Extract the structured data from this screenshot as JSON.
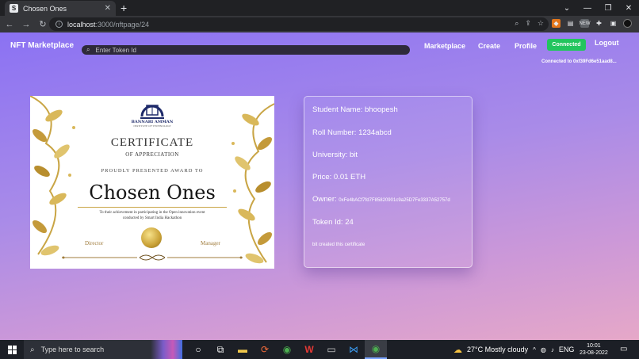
{
  "browser": {
    "tab_title": "Chosen Ones",
    "tab_favicon": "S",
    "url_host": "localhost",
    "url_path": ":3000/nftpage/24",
    "extension_badge": "NEW"
  },
  "navbar": {
    "brand": "NFT Marketplace",
    "search_placeholder": "Enter Token Id",
    "links": [
      "Marketplace",
      "Create",
      "Profile"
    ],
    "connected_label": "Connected",
    "logout_label": "Logout",
    "connection_text": "Connected to 0xf39Fd6e51aad8..."
  },
  "certificate": {
    "college": "BANNARI AMMAN",
    "college_sub": "INSTITUTE OF TECHNOLOGY",
    "heading": "CERTIFICATE",
    "subheading": "OF APPRECIATION",
    "presented": "PROUDLY PRESENTED AWARD TO",
    "recipient": "Chosen Ones",
    "desc_line1": "To their achievement in participating in the Open innovation event",
    "desc_line2": "conducted by Smart India Hackathon",
    "sig_left": "Director",
    "sig_right": "Manager"
  },
  "details": {
    "student_name": "Student Name: bhoopesh",
    "roll_number": "Roll Number: 1234abcd",
    "university": "University: bit",
    "price": "Price: 0.01 ETH",
    "owner_label": "Owner:",
    "owner_value": "0xFe4bACf7fd7F85820901c9a25D7Fe3337A52757d",
    "token_id": "Token Id: 24",
    "note": "bit created this certificate"
  },
  "taskbar": {
    "search_placeholder": "Type here to search",
    "weather": "27°C  Mostly cloudy",
    "language": "ENG",
    "time": "10:01",
    "date": "23-08-2022"
  },
  "colors": {
    "connected_green": "#22c55e",
    "page_gradient_top": "#8b72f3",
    "page_gradient_bottom": "#e6a8c8"
  }
}
